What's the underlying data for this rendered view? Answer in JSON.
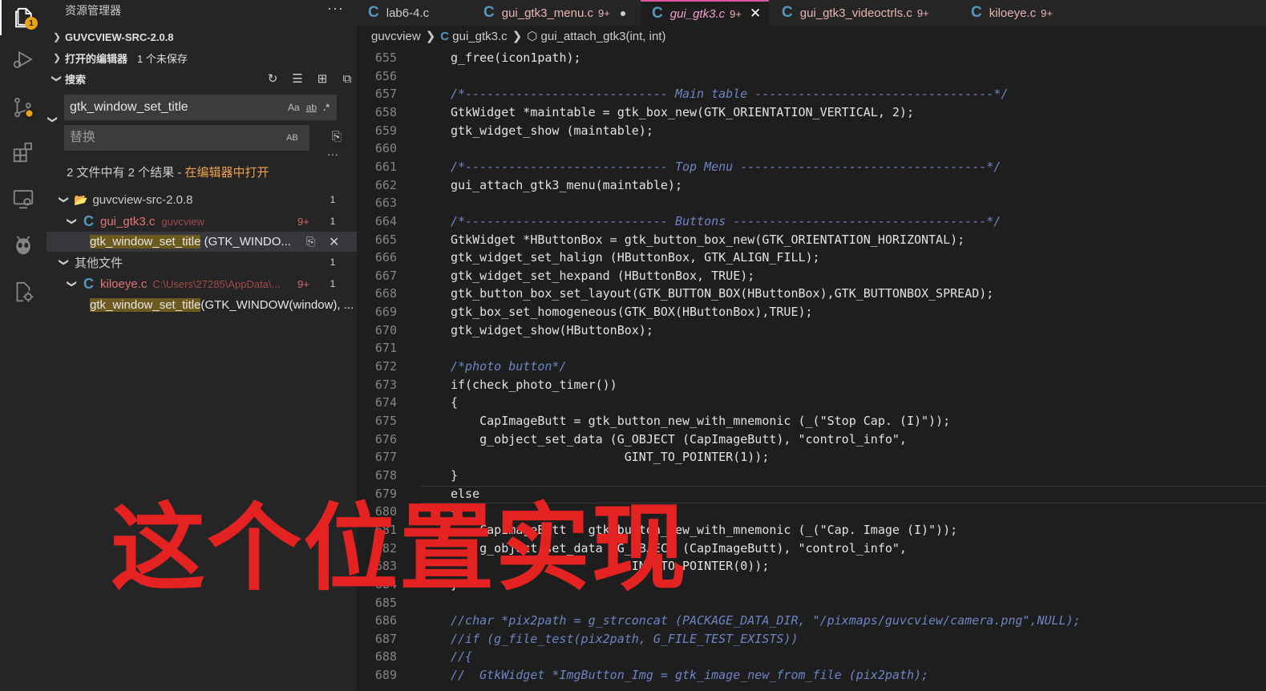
{
  "sidebar": {
    "title": "资源管理器",
    "project": "GUVCVIEW-SRC-2.0.8",
    "open_editors": "打开的编辑器",
    "unsaved": "1 个未保存",
    "search_section": "搜索",
    "search_value": "gtk_window_set_title",
    "replace_placeholder": "替换",
    "opt_case": "Aa",
    "opt_word": "ab",
    "opt_regex": ".*",
    "opt_preserve": "AB",
    "summary": "2 文件中有 2 个结果 - ",
    "summary_link": "在编辑器中打开",
    "tree": {
      "folder1": "guvcview-src-2.0.8",
      "folder1_count": "1",
      "file1": "gui_gtk3.c",
      "file1_path": "guvcview",
      "file1_errors": "9+",
      "file1_count": "1",
      "match1_hl": "gtk_window_set_title",
      "match1_rest": " (GTK_WINDO...",
      "folder2": "其他文件",
      "folder2_count": "1",
      "file2": "kiloeye.c",
      "file2_path": "C:\\Users\\27285\\AppData\\...",
      "file2_errors": "9+",
      "file2_count": "1",
      "match2_hl": "gtk_window_set_title",
      "match2_rest": "(GTK_WINDOW(window), ..."
    }
  },
  "tabs": [
    {
      "name": "lab6-4.c",
      "count": ""
    },
    {
      "name": "gui_gtk3_menu.c",
      "count": "9+"
    },
    {
      "name": "gui_gtk3.c",
      "count": "9+"
    },
    {
      "name": "gui_gtk3_videoctrls.c",
      "count": "9+"
    },
    {
      "name": "kiloeye.c",
      "count": "9+"
    }
  ],
  "breadcrumb": {
    "folder": "guvcview",
    "file": "gui_gtk3.c",
    "symbol": "gui_attach_gtk3(int, int)"
  },
  "code": [
    {
      "n": "655",
      "t": "g_free(icon1path);"
    },
    {
      "n": "656",
      "t": ""
    },
    {
      "n": "657",
      "t": "/*---------------------------- Main table ---------------------------------*/"
    },
    {
      "n": "658",
      "t": "GtkWidget *maintable = gtk_box_new(GTK_ORIENTATION_VERTICAL, 2);"
    },
    {
      "n": "659",
      "t": "gtk_widget_show (maintable);"
    },
    {
      "n": "660",
      "t": ""
    },
    {
      "n": "661",
      "t": "/*---------------------------- Top Menu ----------------------------------*/"
    },
    {
      "n": "662",
      "t": "gui_attach_gtk3_menu(maintable);"
    },
    {
      "n": "663",
      "t": ""
    },
    {
      "n": "664",
      "t": "/*---------------------------- Buttons -----------------------------------*/"
    },
    {
      "n": "665",
      "t": "GtkWidget *HButtonBox = gtk_button_box_new(GTK_ORIENTATION_HORIZONTAL);"
    },
    {
      "n": "666",
      "t": "gtk_widget_set_halign (HButtonBox, GTK_ALIGN_FILL);"
    },
    {
      "n": "667",
      "t": "gtk_widget_set_hexpand (HButtonBox, TRUE);"
    },
    {
      "n": "668",
      "t": "gtk_button_box_set_layout(GTK_BUTTON_BOX(HButtonBox),GTK_BUTTONBOX_SPREAD);"
    },
    {
      "n": "669",
      "t": "gtk_box_set_homogeneous(GTK_BOX(HButtonBox),TRUE);"
    },
    {
      "n": "670",
      "t": "gtk_widget_show(HButtonBox);"
    },
    {
      "n": "671",
      "t": ""
    },
    {
      "n": "672",
      "t": "/*photo button*/"
    },
    {
      "n": "673",
      "t": "if(check_photo_timer())"
    },
    {
      "n": "674",
      "t": "{"
    },
    {
      "n": "675",
      "t": "    CapImageButt = gtk_button_new_with_mnemonic (_(\"Stop Cap. (I)\"));"
    },
    {
      "n": "676",
      "t": "    g_object_set_data (G_OBJECT (CapImageButt), \"control_info\","
    },
    {
      "n": "677",
      "t": "                        GINT_TO_POINTER(1));"
    },
    {
      "n": "678",
      "t": "}"
    },
    {
      "n": "679",
      "t": "else"
    },
    {
      "n": "680",
      "t": "{"
    },
    {
      "n": "681",
      "t": "    CapImageButt = gtk_button_new_with_mnemonic (_(\"Cap. Image (I)\"));"
    },
    {
      "n": "682",
      "t": "    g_object_set_data (G_OBJECT (CapImageButt), \"control_info\","
    },
    {
      "n": "683",
      "t": "                        GINT_TO_POINTER(0));"
    },
    {
      "n": "684",
      "t": "}"
    },
    {
      "n": "685",
      "t": ""
    },
    {
      "n": "686",
      "t": "//char *pix2path = g_strconcat (PACKAGE_DATA_DIR, \"/pixmaps/guvcview/camera.png\",NULL);"
    },
    {
      "n": "687",
      "t": "//if (g_file_test(pix2path, G_FILE_TEST_EXISTS))"
    },
    {
      "n": "688",
      "t": "//{"
    },
    {
      "n": "689",
      "t": "//  GtkWidget *ImgButton_Img = gtk_image_new_from_file (pix2path);"
    }
  ],
  "overlay_text": "这个位置实现",
  "colors": {
    "accent_badge": "#e8a317",
    "active_tab_border": "#d8569e",
    "overlay_red": "#e52222"
  }
}
